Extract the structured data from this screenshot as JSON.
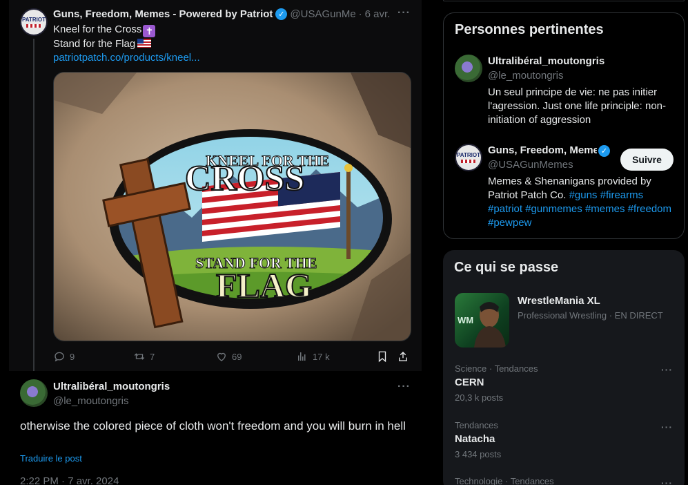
{
  "tweet": {
    "author_name": "Guns, Freedom, Memes - Powered by Patriot",
    "handle": "@USAGunMe",
    "separator": "·",
    "date": "6 avr.",
    "line1": "Kneel for the Cross",
    "line2": "Stand for the Flag",
    "link": "patriotpatch.co/products/kneel...",
    "patch_top_small": "KNEEL FOR THE",
    "patch_top_big": "CROSS",
    "patch_bottom_small": "STAND FOR THE",
    "patch_bottom_big": "FLAG",
    "avatar_text": "PATRIOT",
    "replies": "9",
    "reposts": "7",
    "likes": "69",
    "views": "17 k"
  },
  "reply": {
    "author_name": "Ultralibéral_moutongris",
    "handle": "@le_moutongris",
    "text": "otherwise the colored piece of cloth won't freedom and you will burn in hell",
    "translate": "Traduire le post",
    "timestamp": "2:22 PM · 7 avr. 2024"
  },
  "relevant": {
    "title": "Personnes pertinentes",
    "people": [
      {
        "name": "Ultralibéral_moutongris",
        "handle": "@le_moutongris",
        "bio": "Un seul principe de vie: ne pas initier l'agression. Just one life principle: non-initiation of aggression"
      },
      {
        "name": "Guns, Freedom, Memes",
        "handle": "@USAGunMemes",
        "bio_text": "Memes & Shenanigans provided by Patriot Patch Co.",
        "hashtags": [
          "#guns",
          "#firearms",
          "#patriot",
          "#gunmemes",
          "#memes",
          "#freedom",
          "#pewpew"
        ],
        "follow_label": "Suivre"
      }
    ]
  },
  "happening": {
    "title": "Ce qui se passe",
    "event": {
      "name": "WrestleMania XL",
      "meta": "Professional Wrestling · EN DIRECT",
      "thumb_text": "WM"
    },
    "trends": [
      {
        "meta": "Science · Tendances",
        "name": "CERN",
        "count": "20,3 k posts"
      },
      {
        "meta": "Tendances",
        "name": "Natacha",
        "count": "3 434 posts"
      },
      {
        "meta": "Technologie · Tendances",
        "name": "",
        "count": ""
      }
    ]
  },
  "icons": {
    "more": "···",
    "verified": "✓",
    "cross_emoji": "✝"
  },
  "colors": {
    "accent": "#1d9bf0",
    "background": "#000000",
    "panel": "#16181c",
    "muted": "#71767b",
    "text": "#e7e9ea"
  }
}
